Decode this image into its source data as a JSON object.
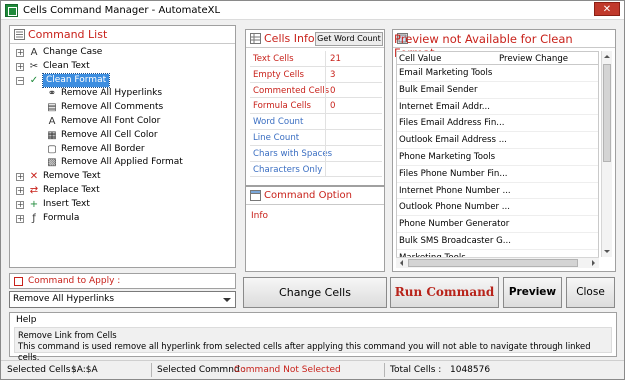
{
  "window": {
    "title": "Cells Command Manager - AutomateXL"
  },
  "command_list": {
    "title": "Command List",
    "items": [
      {
        "label": "Change Case",
        "icon": "change-case-icon",
        "expander": "+",
        "level": 0
      },
      {
        "label": "Clean Text",
        "icon": "clean-text-icon",
        "expander": "+",
        "level": 0
      },
      {
        "label": "Clean Format",
        "icon": "check-icon",
        "expander": "-",
        "level": 0,
        "selected": true
      },
      {
        "label": "Remove All Hyperlinks",
        "icon": "hyperlink-icon",
        "expander": "",
        "level": 1
      },
      {
        "label": "Remove All Comments",
        "icon": "comment-icon",
        "expander": "",
        "level": 1
      },
      {
        "label": "Remove All Font Color",
        "icon": "font-color-icon",
        "expander": "",
        "level": 1
      },
      {
        "label": "Remove All Cell Color",
        "icon": "cell-color-icon",
        "expander": "",
        "level": 1
      },
      {
        "label": "Remove All Border",
        "icon": "border-icon",
        "expander": "",
        "level": 1
      },
      {
        "label": "Remove All Applied Format",
        "icon": "format-icon",
        "expander": "",
        "level": 1
      },
      {
        "label": "Remove Text",
        "icon": "remove-text-icon",
        "expander": "+",
        "level": 0
      },
      {
        "label": "Replace Text",
        "icon": "replace-text-icon",
        "expander": "+",
        "level": 0
      },
      {
        "label": "Insert Text",
        "icon": "insert-text-icon",
        "expander": "+",
        "level": 0
      },
      {
        "label": "Formula",
        "icon": "formula-icon",
        "expander": "+",
        "level": 0
      }
    ]
  },
  "apply": {
    "label": "Command to Apply :",
    "selected": "Remove All Hyperlinks"
  },
  "cells_info": {
    "title": "Cells Info",
    "word_count_button": "Get Word Count",
    "rows": [
      {
        "key": "Text Cells",
        "value": "21",
        "tone": "red"
      },
      {
        "key": "Empty Cells",
        "value": "3",
        "tone": "red"
      },
      {
        "key": "Commented Cells",
        "value": "0",
        "tone": "red"
      },
      {
        "key": "Formula Cells",
        "value": "0",
        "tone": "red"
      },
      {
        "key": "Word Count",
        "value": "",
        "tone": "blue"
      },
      {
        "key": "Line Count",
        "value": "",
        "tone": "blue"
      },
      {
        "key": "Chars with Spaces",
        "value": "",
        "tone": "blue"
      },
      {
        "key": "Characters Only",
        "value": "",
        "tone": "blue"
      }
    ]
  },
  "command_option": {
    "title": "Command Option",
    "info": "Info"
  },
  "preview": {
    "title": "Preview not Available for Clean Format",
    "col_cell_value": "Cell Value",
    "col_preview_change": "Preview Change",
    "rows": [
      "Email Marketing Tools",
      "Bulk    Email    Sender",
      "Internet    Email    Addr...",
      "Files Email Address    Fin...",
      "Outlook Email Address ...",
      "Phone Marketing Tools",
      "Files Phone Number Fin...",
      "Internet Phone Number ...",
      "Outlook Phone Number ...",
      "Phone Number Generator",
      "Bulk SMS Broadcaster G...",
      "Marketing Tools"
    ]
  },
  "buttons": {
    "change_cells": "Change Cells",
    "run_command": "Run Command",
    "preview": "Preview",
    "close": "Close"
  },
  "help": {
    "label": "Help",
    "line1": "Remove Link from Cells",
    "line2": "This command is used remove all hyperlink from selected cells after applying this command you will not able to navigate through linked cells."
  },
  "status": {
    "selected_cells_label": "Selected Cells :",
    "selected_cells_value": "$A:$A",
    "selected_command_label": "Selected Commnd :",
    "selected_command_value": "Command Not Selected",
    "total_cells_label": "Total Cells :",
    "total_cells_value": "1048576"
  },
  "colors": {
    "accent_red": "#c8221b",
    "accent_blue": "#3a6ec2",
    "selection": "#3d8ee0"
  }
}
